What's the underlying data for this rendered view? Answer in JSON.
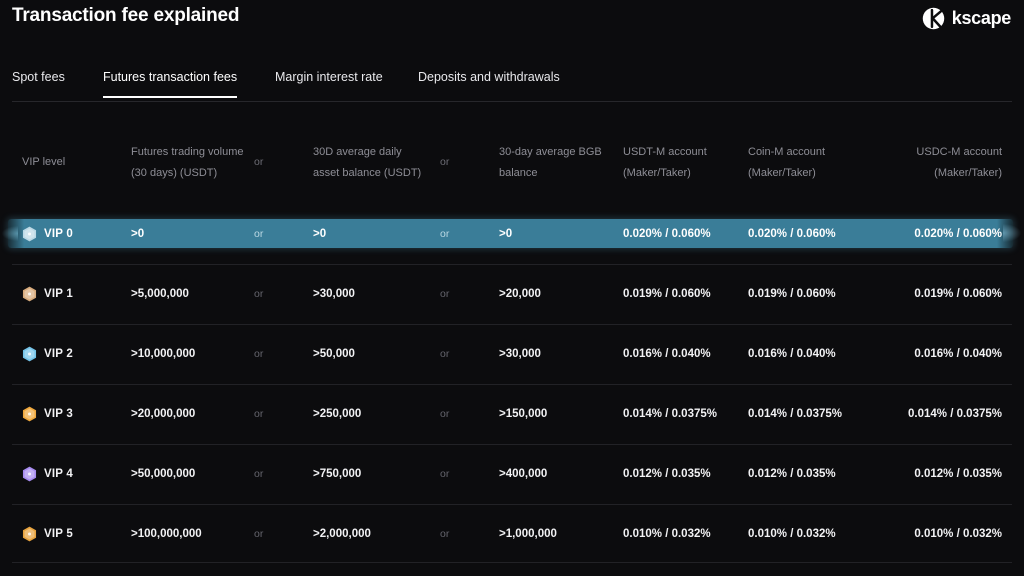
{
  "header": {
    "title": "Transaction fee explained",
    "brand_name": "kscape",
    "brand_icon": "kscape-logo-icon"
  },
  "tabs": [
    {
      "label": "Spot fees",
      "active": false
    },
    {
      "label": "Futures transaction fees",
      "active": true
    },
    {
      "label": "Margin interest rate",
      "active": false
    },
    {
      "label": "Deposits and withdrawals",
      "active": false
    }
  ],
  "table": {
    "columns": [
      {
        "key": "vip",
        "label": "VIP level",
        "align": "left"
      },
      {
        "key": "volume",
        "label": "Futures trading volume\n(30 days) (USDT)",
        "align": "left"
      },
      {
        "key": "or1",
        "label": "or",
        "align": "left"
      },
      {
        "key": "balance",
        "label": "30D average daily\nasset balance (USDT)",
        "align": "left"
      },
      {
        "key": "or2",
        "label": "or",
        "align": "left"
      },
      {
        "key": "bgb",
        "label": "30-day average BGB\nbalance",
        "align": "left"
      },
      {
        "key": "usdtm",
        "label": "USDT-M account\n(Maker/Taker)",
        "align": "left"
      },
      {
        "key": "coinm",
        "label": "Coin-M account\n(Maker/Taker)",
        "align": "left"
      },
      {
        "key": "usdcm",
        "label": "USDC-M account\n(Maker/Taker)",
        "align": "right"
      }
    ],
    "rows": [
      {
        "vip": "VIP 0",
        "badge_color": "#bcd9e6",
        "highlighted": true,
        "volume": ">0",
        "or1": "or",
        "balance": ">0",
        "or2": "or",
        "bgb": ">0",
        "usdtm": "0.020% / 0.060%",
        "coinm": "0.020% / 0.060%",
        "usdcm": "0.020% / 0.060%"
      },
      {
        "vip": "VIP 1",
        "badge_color": "#d8ab7c",
        "highlighted": false,
        "volume": ">5,000,000",
        "or1": "or",
        "balance": ">30,000",
        "or2": "or",
        "bgb": ">20,000",
        "usdtm": "0.019% / 0.060%",
        "coinm": "0.019% / 0.060%",
        "usdcm": "0.019% / 0.060%"
      },
      {
        "vip": "VIP 2",
        "badge_color": "#74c3e8",
        "highlighted": false,
        "volume": ">10,000,000",
        "or1": "or",
        "balance": ">50,000",
        "or2": "or",
        "bgb": ">30,000",
        "usdtm": "0.016% / 0.040%",
        "coinm": "0.016% / 0.040%",
        "usdcm": "0.016% / 0.040%"
      },
      {
        "vip": "VIP 3",
        "badge_color": "#f0a83c",
        "highlighted": false,
        "volume": ">20,000,000",
        "or1": "or",
        "balance": ">250,000",
        "or2": "or",
        "bgb": ">150,000",
        "usdtm": "0.014% / 0.0375%",
        "coinm": "0.014% / 0.0375%",
        "usdcm": "0.014% / 0.0375%"
      },
      {
        "vip": "VIP 4",
        "badge_color": "#a78bf0",
        "highlighted": false,
        "volume": ">50,000,000",
        "or1": "or",
        "balance": ">750,000",
        "or2": "or",
        "bgb": ">400,000",
        "usdtm": "0.012% / 0.035%",
        "coinm": "0.012% / 0.035%",
        "usdcm": "0.012% / 0.035%"
      },
      {
        "vip": "VIP 5",
        "badge_color": "#e8a33d",
        "highlighted": false,
        "volume": ">100,000,000",
        "or1": "or",
        "balance": ">2,000,000",
        "or2": "or",
        "bgb": ">1,000,000",
        "usdtm": "0.010% / 0.032%",
        "coinm": "0.010% / 0.032%",
        "usdcm": "0.010% / 0.032%"
      }
    ]
  },
  "theme": {
    "background": "#0c0c0e",
    "highlight_row": "#3a7d98",
    "text_primary": "#f2f2f4",
    "text_muted": "#8e8e96",
    "divider": "#222226"
  }
}
